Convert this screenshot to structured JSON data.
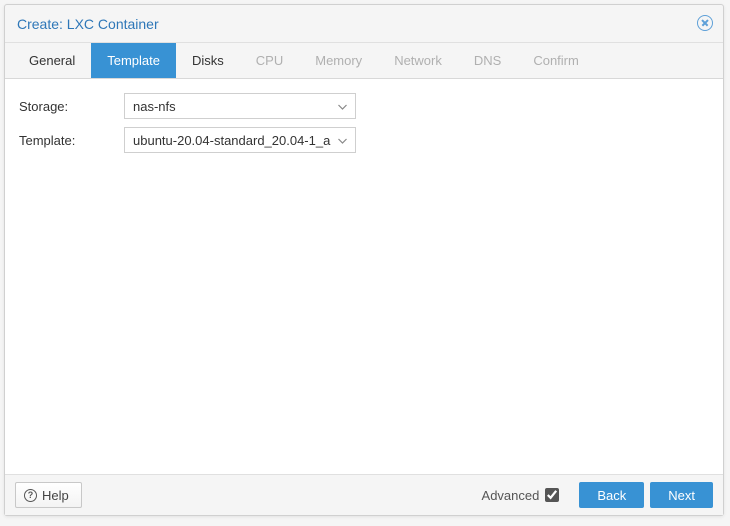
{
  "window": {
    "title": "Create: LXC Container"
  },
  "tabs": [
    {
      "label": "General",
      "state": "enabled"
    },
    {
      "label": "Template",
      "state": "active"
    },
    {
      "label": "Disks",
      "state": "enabled"
    },
    {
      "label": "CPU",
      "state": "disabled"
    },
    {
      "label": "Memory",
      "state": "disabled"
    },
    {
      "label": "Network",
      "state": "disabled"
    },
    {
      "label": "DNS",
      "state": "disabled"
    },
    {
      "label": "Confirm",
      "state": "disabled"
    }
  ],
  "form": {
    "storage": {
      "label": "Storage:",
      "value": "nas-nfs"
    },
    "template": {
      "label": "Template:",
      "value": "ubuntu-20.04-standard_20.04-1_a"
    }
  },
  "footer": {
    "help": "Help",
    "advanced_label": "Advanced",
    "advanced_checked": true,
    "back": "Back",
    "next": "Next"
  }
}
